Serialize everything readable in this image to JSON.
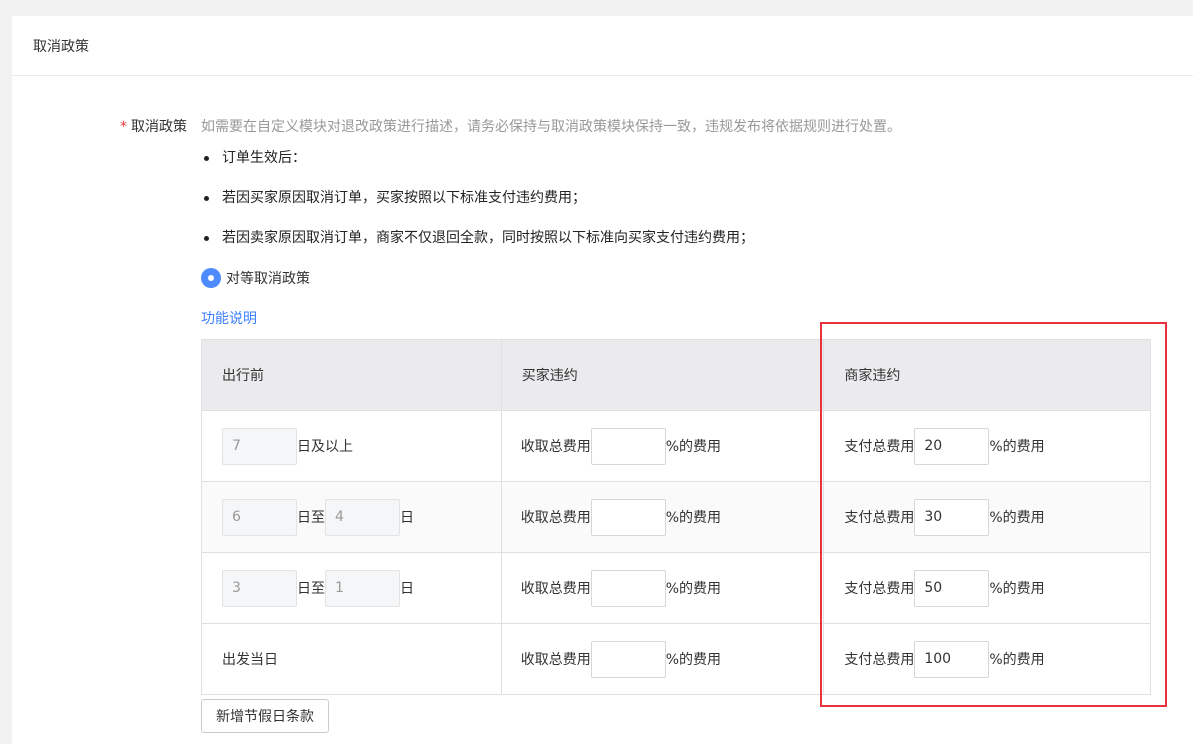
{
  "page_title": "取消政策",
  "form": {
    "required_mark": "*",
    "label": "取消政策",
    "hint": "如需要在自定义模块对退改政策进行描述，请务必保持与取消政策模块保持一致，违规发布将依据规则进行处置。"
  },
  "bullets": [
    "订单生效后：",
    "若因买家原因取消订单，买家按照以下标准支付违约费用；",
    "若因卖家原因取消订单，商家不仅退回全款，同时按照以下标准向买家支付违约费用；"
  ],
  "radio_label": "对等取消政策",
  "function_link": "功能说明",
  "table": {
    "headers": [
      "出行前",
      "买家违约",
      "商家违约"
    ],
    "rows": [
      {
        "from": "7",
        "from_suffix": "日及以上",
        "buyer_prefix": "收取总费用",
        "buyer_value": "",
        "buyer_suffix": "%的费用",
        "seller_prefix": "支付总费用",
        "seller_value": "20",
        "seller_suffix": "%的费用"
      },
      {
        "from": "6",
        "mid": "日至",
        "to": "4",
        "to_suffix": "日",
        "buyer_prefix": "收取总费用",
        "buyer_value": "",
        "buyer_suffix": "%的费用",
        "seller_prefix": "支付总费用",
        "seller_value": "30",
        "seller_suffix": "%的费用"
      },
      {
        "from": "3",
        "mid": "日至",
        "to": "1",
        "to_suffix": "日",
        "buyer_prefix": "收取总费用",
        "buyer_value": "",
        "buyer_suffix": "%的费用",
        "seller_prefix": "支付总费用",
        "seller_value": "50",
        "seller_suffix": "%的费用"
      },
      {
        "label": "出发当日",
        "buyer_prefix": "收取总费用",
        "buyer_value": "",
        "buyer_suffix": "%的费用",
        "seller_prefix": "支付总费用",
        "seller_value": "100",
        "seller_suffix": "%的费用"
      }
    ]
  },
  "add_button": "新增节假日条款",
  "colors": {
    "accent": "#4d8bff",
    "link": "#3d7fff",
    "required": "#e4393c",
    "highlight": "#e8323c"
  }
}
